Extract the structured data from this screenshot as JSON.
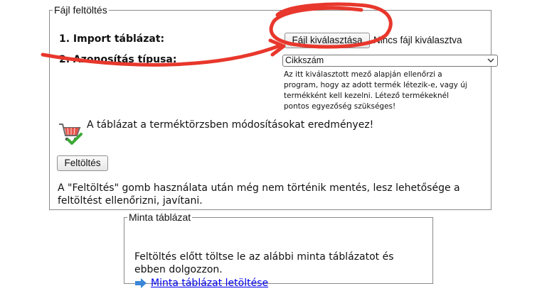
{
  "upload_panel": {
    "legend": "Fájl feltöltés",
    "import_label": "1. Import táblázat:",
    "file_button_label": "Fájl kiválasztása",
    "file_status": "Nincs fájl kiválasztva",
    "id_type_label": "2. Azonosítás típusa:",
    "id_type_selected": "Cikkszám",
    "hint": "Az itt kiválasztott mező alapján ellenőrzi a program, hogy az adott termék létezik-e, vagy új termékként kell kezelni. Létező termékeknél pontos egyezőség szükséges!",
    "warning": "A táblázat a terméktörzsben módosításokat eredményez!",
    "upload_button_label": "Feltöltés",
    "note": "A \"Feltöltés\" gomb használata után még nem történik mentés, lesz lehetősége a feltöltést ellenőrizni, javítani."
  },
  "sample_panel": {
    "legend": "Minta táblázat",
    "text": "Feltöltés előtt töltse le az alábbi minta táblázatot és ebben dolgozzon.",
    "download_link": "Minta táblázat letöltése"
  },
  "icons": {
    "cart": "shopping-cart-check-icon",
    "arrow": "arrow-right-icon",
    "chevron": "chevron-down-icon"
  },
  "colors": {
    "annotation_red": "#e8372c",
    "link_blue": "#0000ee",
    "arrow_blue": "#3a86d8",
    "check_green": "#3aa835"
  }
}
